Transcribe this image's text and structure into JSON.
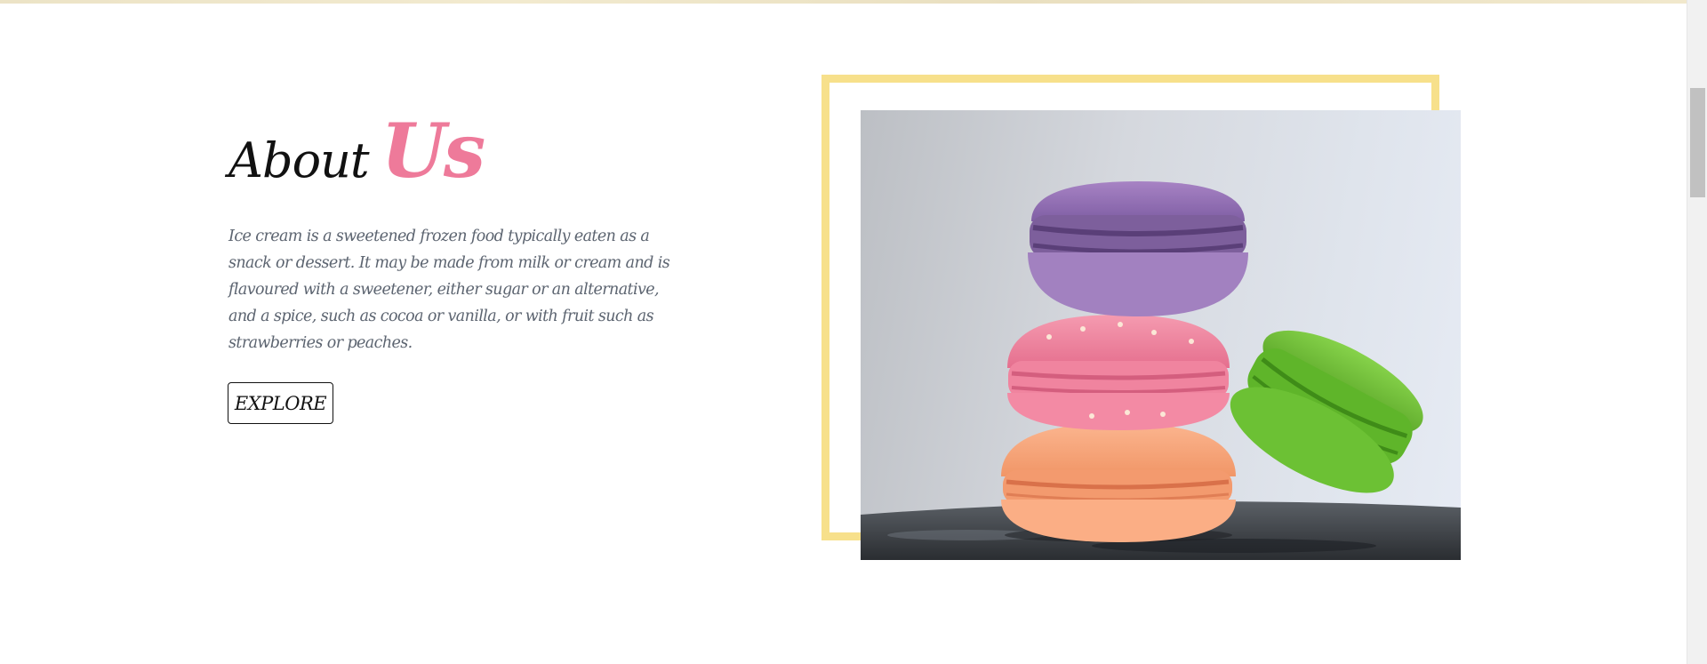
{
  "about": {
    "title_word1": "About",
    "title_word2": "Us",
    "description": "Ice cream is a sweetened frozen food typically eaten as a snack or dessert. It may be made from milk or cream and is flavoured with a sweetener, either sugar or an alternative, and a spice, such as cocoa or vanilla, or with fruit such as strawberries or peaches.",
    "button_label": "EXPLORE"
  },
  "colors": {
    "accent_pink": "#ee7a9a",
    "frame_yellow": "#f7e08b",
    "text_dark": "#111111",
    "text_muted": "#5c6470"
  },
  "image": {
    "subject": "stacked-macarons-photo"
  }
}
